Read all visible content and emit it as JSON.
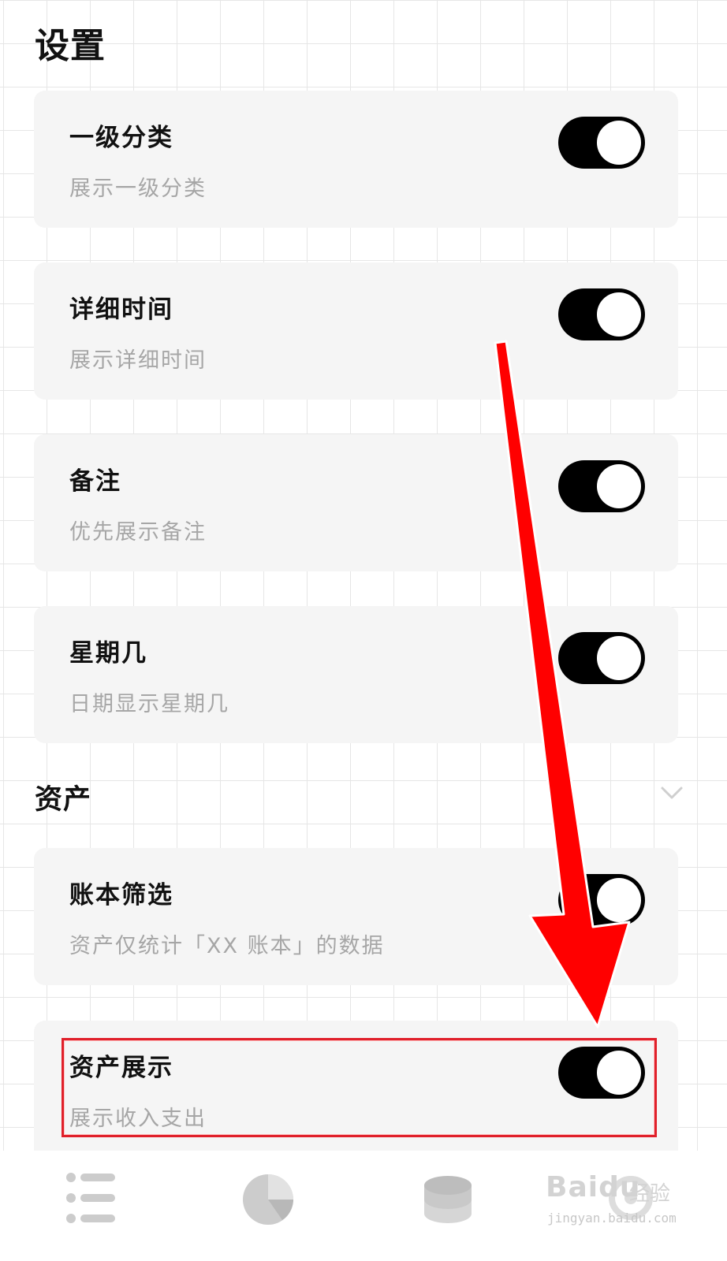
{
  "page": {
    "title": "设置"
  },
  "settings": [
    {
      "title": "一级分类",
      "desc": "展示一级分类",
      "enabled": true
    },
    {
      "title": "详细时间",
      "desc": "展示详细时间",
      "enabled": true
    },
    {
      "title": "备注",
      "desc": "优先展示备注",
      "enabled": true
    },
    {
      "title": "星期几",
      "desc": "日期显示星期几",
      "enabled": true
    }
  ],
  "assets_section": {
    "title": "资产",
    "items": [
      {
        "title": "账本筛选",
        "desc": "资产仅统计「XX 账本」的数据",
        "enabled": true
      },
      {
        "title": "资产展示",
        "desc": "展示收入支出",
        "enabled": true
      }
    ]
  },
  "bottom_nav": {
    "items": [
      {
        "icon": "list-icon"
      },
      {
        "icon": "pie-chart-icon"
      },
      {
        "icon": "coin-stack-icon"
      },
      {
        "icon": "settings-icon"
      }
    ]
  },
  "watermark": {
    "brand": "Baidu",
    "cn": "经验",
    "url": "jingyan.baidu.com"
  },
  "colors": {
    "toggle_on": "#000000",
    "card_bg": "#f5f5f5",
    "desc_text": "#a6a6a6",
    "annotation_red": "#ff0000"
  }
}
